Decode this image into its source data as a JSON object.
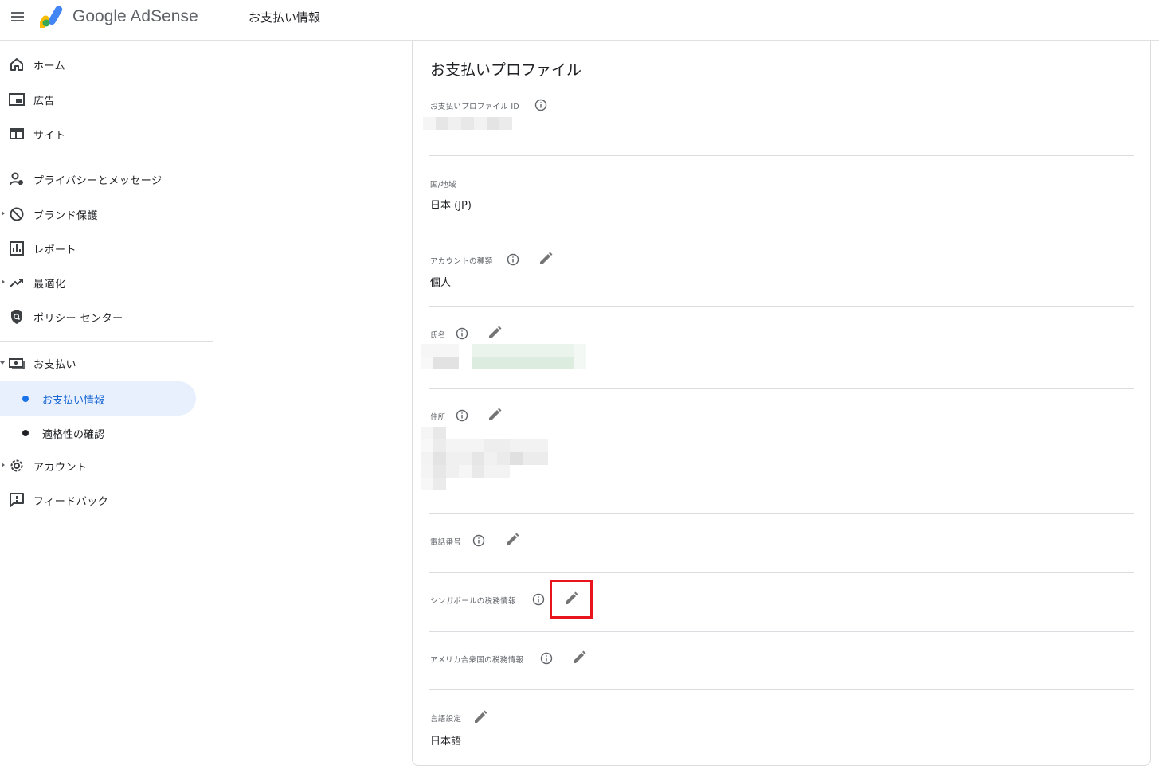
{
  "header": {
    "app_name": "Google AdSense",
    "page_title": "お支払い情報"
  },
  "sidebar": {
    "items": [
      {
        "label": "ホーム",
        "icon": "home-icon"
      },
      {
        "label": "広告",
        "icon": "ads-icon"
      },
      {
        "label": "サイト",
        "icon": "sites-icon"
      },
      {
        "label": "プライバシーとメッセージ",
        "icon": "privacy-icon"
      },
      {
        "label": "ブランド保護",
        "icon": "block-icon"
      },
      {
        "label": "レポート",
        "icon": "report-icon"
      },
      {
        "label": "最適化",
        "icon": "trending-icon"
      },
      {
        "label": "ポリシー センター",
        "icon": "policy-shield-icon"
      },
      {
        "label": "お支払い",
        "icon": "payments-icon"
      },
      {
        "label": "アカウント",
        "icon": "gear-icon"
      },
      {
        "label": "フィードバック",
        "icon": "feedback-icon"
      }
    ],
    "payments_sub": [
      {
        "label": "お支払い情報",
        "active": true
      },
      {
        "label": "適格性の確認",
        "active": false
      }
    ]
  },
  "profile": {
    "title": "お支払いプロファイル",
    "fields": {
      "profile_id": {
        "label": "お支払いプロファイル ID"
      },
      "country": {
        "label": "国/地域",
        "value": "日本 (JP)"
      },
      "account_type": {
        "label": "アカウントの種類",
        "value": "個人"
      },
      "name": {
        "label": "氏名"
      },
      "address": {
        "label": "住所"
      },
      "phone": {
        "label": "電話番号"
      },
      "sg_tax": {
        "label": "シンガポールの税務情報"
      },
      "us_tax": {
        "label": "アメリカ合衆国の税務情報"
      },
      "language": {
        "label": "言語設定",
        "value": "日本語"
      }
    }
  },
  "colors": {
    "accent": "#1a73e8",
    "active_bg": "#e8f0fe",
    "highlight": "#e8141d"
  }
}
